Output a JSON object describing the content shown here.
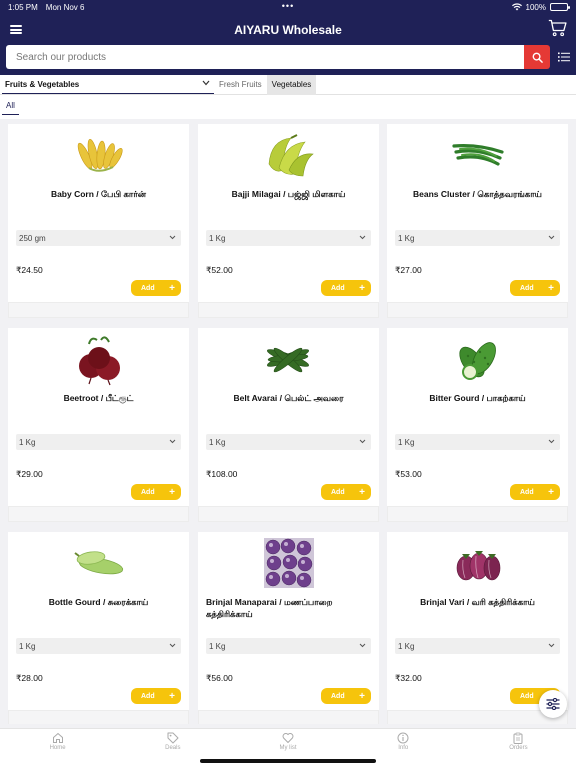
{
  "status": {
    "time": "1:05 PM",
    "date": "Mon Nov 6",
    "dots": "•••",
    "battery": "100%"
  },
  "header": {
    "title": "AIYARU Wholesale"
  },
  "search": {
    "placeholder": "Search our products"
  },
  "filters": {
    "category": "Fruits & Vegetables",
    "subtabs": [
      {
        "label": "Fresh Fruits"
      },
      {
        "label": "Vegetables"
      }
    ],
    "active_subtab": "Vegetables",
    "all_tab": "All"
  },
  "products": [
    {
      "name": "Baby Corn / பேபி கார்ன்",
      "unit": "250 gm",
      "price": "₹24.50",
      "add": "Add",
      "icon": "baby-corn-image"
    },
    {
      "name": "Bajji Milagai / பஜ்ஜி மிளகாய்",
      "unit": "1 Kg",
      "price": "₹52.00",
      "add": "Add",
      "icon": "bajji-chilli-image"
    },
    {
      "name": "Beans Cluster / கொத்தவரங்காய்",
      "unit": "1 Kg",
      "price": "₹27.00",
      "add": "Add",
      "icon": "cluster-beans-image"
    },
    {
      "name": "Beetroot / பீட்ரூட்",
      "unit": "1 Kg",
      "price": "₹29.00",
      "add": "Add",
      "icon": "beetroot-image"
    },
    {
      "name": "Belt Avarai / பெல்ட் அவரை",
      "unit": "1 Kg",
      "price": "₹108.00",
      "add": "Add",
      "icon": "belt-avarai-image"
    },
    {
      "name": "Bitter Gourd / பாகற்காய்",
      "unit": "1 Kg",
      "price": "₹53.00",
      "add": "Add",
      "icon": "bitter-gourd-image"
    },
    {
      "name": "Bottle Gourd / சுரைக்காய்",
      "unit": "1 Kg",
      "price": "₹28.00",
      "add": "Add",
      "icon": "bottle-gourd-image"
    },
    {
      "name": "Brinjal Manaparai / மணப்பாறை கத்திரிக்காய்",
      "unit": "1 Kg",
      "price": "₹56.00",
      "add": "Add",
      "icon": "brinjal-manaparai-image"
    },
    {
      "name": "Brinjal Vari / வரி கத்திரிக்காய்",
      "unit": "1 Kg",
      "price": "₹32.00",
      "add": "Add",
      "icon": "brinjal-vari-image"
    }
  ],
  "nav": [
    {
      "label": "Home",
      "icon": "home-icon"
    },
    {
      "label": "Deals",
      "icon": "tag-icon"
    },
    {
      "label": "My list",
      "icon": "heart-icon"
    },
    {
      "label": "Info",
      "icon": "info-icon"
    },
    {
      "label": "Orders",
      "icon": "clipboard-icon"
    }
  ],
  "colors": {
    "header": "#1f2157",
    "search_button": "#e53935",
    "add_button": "#f6c40c"
  }
}
